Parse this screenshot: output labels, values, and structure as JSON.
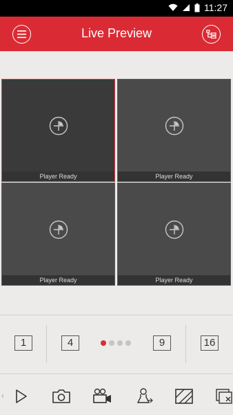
{
  "status_bar": {
    "time": "11:27"
  },
  "header": {
    "title": "Live Preview"
  },
  "tiles": [
    {
      "caption": "Player Ready"
    },
    {
      "caption": "Player Ready"
    },
    {
      "caption": "Player Ready"
    },
    {
      "caption": "Player Ready"
    }
  ],
  "layouts": {
    "one": "1",
    "four": "4",
    "nine": "9",
    "sixteen": "16"
  },
  "toolbar": {
    "icons": [
      "play-icon",
      "camera-icon",
      "record-video-icon",
      "ptz-control-icon",
      "image-quality-icon",
      "close-all-icon"
    ]
  },
  "colors": {
    "accent": "#da2b35",
    "tile_border_selected": "#e23a42"
  },
  "pager": {
    "active_page": 1,
    "total_pages": 4
  }
}
